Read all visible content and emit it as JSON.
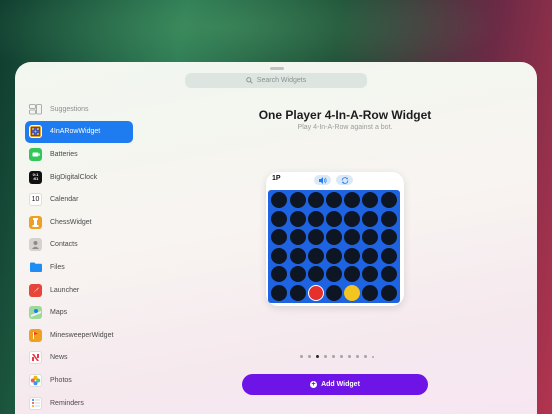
{
  "search": {
    "placeholder": "Search Widgets"
  },
  "sidebar": {
    "items": [
      {
        "label": "Suggestions",
        "icon": "suggestions-icon"
      },
      {
        "label": "4InARowWidget",
        "icon": "4inarow-app-icon"
      },
      {
        "label": "Batteries",
        "icon": "batteries-app-icon"
      },
      {
        "label": "BigDigitalClock",
        "icon": "bigdigitalclock-app-icon",
        "icon_text": "0:1\n:01"
      },
      {
        "label": "Calendar",
        "icon": "calendar-app-icon",
        "icon_text": "10"
      },
      {
        "label": "ChessWidget",
        "icon": "chesswidget-app-icon"
      },
      {
        "label": "Contacts",
        "icon": "contacts-app-icon"
      },
      {
        "label": "Files",
        "icon": "files-app-icon"
      },
      {
        "label": "Launcher",
        "icon": "launcher-app-icon"
      },
      {
        "label": "Maps",
        "icon": "maps-app-icon"
      },
      {
        "label": "MinesweeperWidget",
        "icon": "minesweeper-app-icon"
      },
      {
        "label": "News",
        "icon": "news-app-icon"
      },
      {
        "label": "Photos",
        "icon": "photos-app-icon"
      },
      {
        "label": "Reminders",
        "icon": "reminders-app-icon"
      }
    ]
  },
  "detail": {
    "title": "One Player 4-In-A-Row Widget",
    "subtitle": "Play 4-In-A-Row against a bot."
  },
  "widget": {
    "player": "1P",
    "board": {
      "rows": 6,
      "cols": 7,
      "red_cells": [
        [
          5,
          2
        ]
      ],
      "yellow_cells": [
        [
          5,
          4
        ]
      ]
    }
  },
  "pagination": {
    "count": 10,
    "active_index": 2
  },
  "add_button": {
    "label": "Add Widget"
  },
  "colors": {
    "accent": "#1e7cf0",
    "add_button": "#6e14e6",
    "board": "#1d63e2"
  }
}
